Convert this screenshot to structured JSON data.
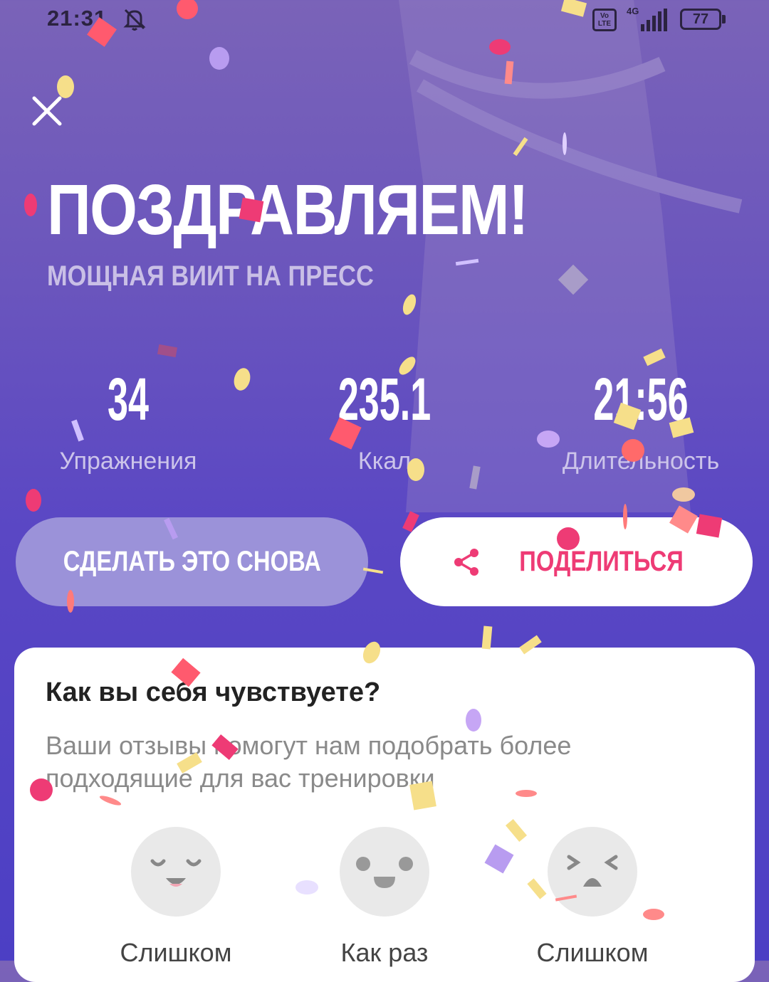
{
  "status_bar": {
    "time": "21:31",
    "network": "4G",
    "volte": "Vo LTE",
    "battery": "77"
  },
  "header": {
    "title": "ПОЗДРАВЛЯЕМ!",
    "subtitle": "МОЩНАЯ ВИИТ НА ПРЕСС"
  },
  "stats": [
    {
      "value": "34",
      "label": "Упражнения"
    },
    {
      "value": "235.1",
      "label": "Ккал"
    },
    {
      "value": "21:56",
      "label": "Длительность"
    }
  ],
  "buttons": {
    "again": "СДЕЛАТЬ ЭТО СНОВА",
    "share": "ПОДЕЛИТЬСЯ"
  },
  "feedback": {
    "title": "Как вы себя чувствуете?",
    "description": "Ваши отзывы помогут нам подобрать более подходящие для вас тренировки",
    "options": [
      "Слишком",
      "Как раз",
      "Слишком"
    ]
  },
  "colors": {
    "accent": "#ee3b75",
    "button_secondary": "#9b92d9",
    "background": "#5a47c4"
  },
  "icons": [
    "bell-off-icon",
    "close-icon",
    "share-icon",
    "relaxed-face-icon",
    "neutral-face-icon",
    "strained-face-icon"
  ]
}
